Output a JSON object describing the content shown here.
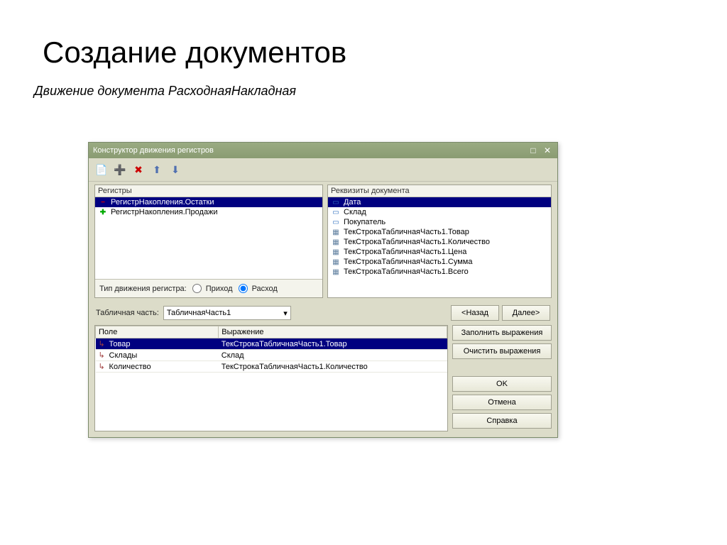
{
  "slide": {
    "title": "Создание документов",
    "subtitle": "Движение документа РасходнаяНакладная"
  },
  "window": {
    "title": "Конструктор движения регистров",
    "toolbar": {
      "t1": "add",
      "t2": "add-x",
      "t3": "remove-x",
      "t4": "up",
      "t5": "down"
    },
    "registers": {
      "header": "Регистры",
      "items": [
        {
          "label": "РегистрНакопления.Остатки",
          "icon": "minus",
          "selected": true
        },
        {
          "label": "РегистрНакопления.Продажи",
          "icon": "plus",
          "selected": false
        }
      ],
      "movementTypeLabel": "Тип движения регистра:",
      "radio1": "Приход",
      "radio2": "Расход",
      "radioSelected": "Расход"
    },
    "docFields": {
      "header": "Реквизиты документа",
      "items": [
        {
          "label": "Дата",
          "icon": "blue",
          "selected": true
        },
        {
          "label": "Склад",
          "icon": "blue",
          "selected": false
        },
        {
          "label": "Покупатель",
          "icon": "blue",
          "selected": false
        },
        {
          "label": "ТекСтрокаТабличнаяЧасть1.Товар",
          "icon": "doc",
          "selected": false
        },
        {
          "label": "ТекСтрокаТабличнаяЧасть1.Количество",
          "icon": "doc",
          "selected": false
        },
        {
          "label": "ТекСтрокаТабличнаяЧасть1.Цена",
          "icon": "doc",
          "selected": false
        },
        {
          "label": "ТекСтрокаТабличнаяЧасть1.Сумма",
          "icon": "doc",
          "selected": false
        },
        {
          "label": "ТекСтрокаТабличнаяЧасть1.Всего",
          "icon": "doc",
          "selected": false
        }
      ]
    },
    "tabPart": {
      "label": "Табличная часть:",
      "value": "ТабличнаяЧасть1"
    },
    "navBtns": {
      "back": "<Назад",
      "next": "Далее>"
    },
    "actionBtns": {
      "fill": "Заполнить выражения",
      "clear": "Очистить выражения"
    },
    "dialogBtns": {
      "ok": "OK",
      "cancel": "Отмена",
      "help": "Справка"
    },
    "table": {
      "col1": "Поле",
      "col2": "Выражение",
      "rows": [
        {
          "field": "Товар",
          "expr": "ТекСтрокаТабличнаяЧасть1.Товар",
          "selected": true
        },
        {
          "field": "Склады",
          "expr": "Склад",
          "selected": false
        },
        {
          "field": "Количество",
          "expr": "ТекСтрокаТабличнаяЧасть1.Количество",
          "selected": false
        }
      ]
    }
  }
}
